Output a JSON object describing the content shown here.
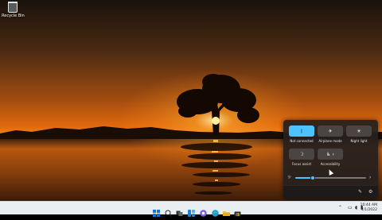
{
  "desktop": {
    "recycle_bin_label": "Recycle Bin"
  },
  "quick_settings": {
    "tiles": [
      {
        "label": "Not connected",
        "icon": "bluetooth-icon",
        "active": true
      },
      {
        "label": "Airplane mode",
        "icon": "airplane-icon",
        "active": false
      },
      {
        "label": "Night light",
        "icon": "night-light-icon",
        "active": false
      },
      {
        "label": "Focus assist",
        "icon": "focus-assist-icon",
        "active": false
      },
      {
        "label": "Accessibility",
        "icon": "accessibility-icon",
        "active": false
      }
    ],
    "brightness_level": 0.25,
    "accent_color": "#4cc2ff",
    "footer_icons": [
      "edit-icon",
      "settings-icon"
    ]
  },
  "taskbar": {
    "apps": [
      "start-icon",
      "search-icon",
      "task-view-icon",
      "widgets-icon",
      "chat-icon",
      "edge-icon",
      "file-explorer-icon",
      "store-icon"
    ],
    "tray_icons": [
      "chevron-up-icon",
      "network-icon",
      "volume-icon",
      "battery-icon"
    ],
    "time": "10:44 AM",
    "date": "4/1/2022"
  }
}
